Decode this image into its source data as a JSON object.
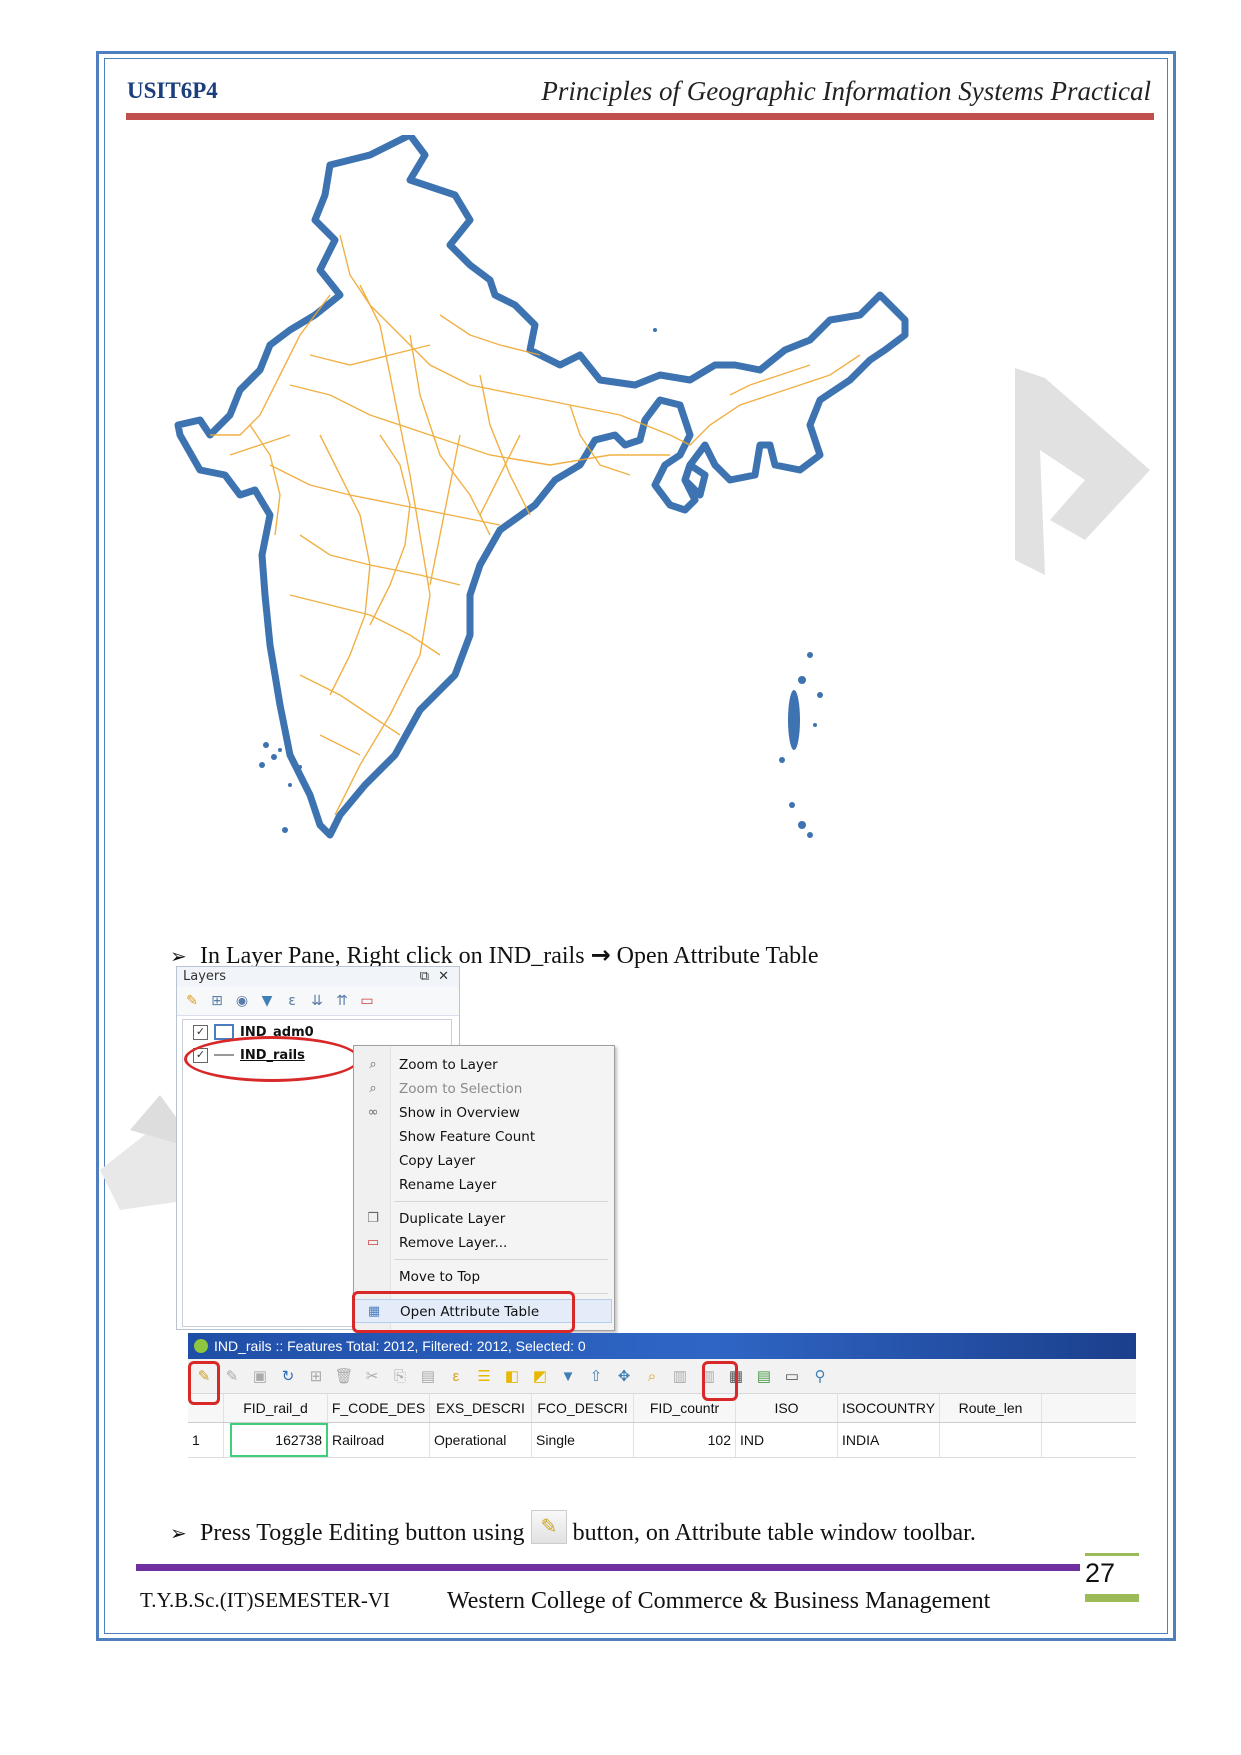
{
  "header": {
    "code": "USIT6P4",
    "title": "Principles of Geographic Information Systems Practical"
  },
  "steps": [
    {
      "text": "In Layer Pane, Right click on IND_rails",
      "arrow": "→",
      "action": "Open Attribute Table"
    },
    {
      "text_before": "Press Toggle Editing button using",
      "text_after": "button, on Attribute table window toolbar."
    }
  ],
  "layers_panel": {
    "title": "Layers",
    "layers": [
      {
        "name": "IND_adm0",
        "checked": true
      },
      {
        "name": "IND_rails",
        "checked": true
      }
    ]
  },
  "context_menu": {
    "items": [
      {
        "label": "Zoom to Layer",
        "enabled": true,
        "icon": "zoom-icon"
      },
      {
        "label": "Zoom to Selection",
        "enabled": false,
        "icon": "zoom-icon"
      },
      {
        "label": "Show in Overview",
        "enabled": true,
        "icon": "overview-icon"
      },
      {
        "label": "Show Feature Count",
        "enabled": true,
        "icon": ""
      },
      {
        "label": "Copy Layer",
        "enabled": true,
        "icon": ""
      },
      {
        "label": "Rename Layer",
        "enabled": true,
        "icon": ""
      },
      {
        "label": "Duplicate Layer",
        "enabled": true,
        "icon": "duplicate-icon"
      },
      {
        "label": "Remove Layer...",
        "enabled": true,
        "icon": "remove-icon"
      },
      {
        "label": "Move to Top",
        "enabled": true,
        "icon": ""
      },
      {
        "label": "Open Attribute Table",
        "enabled": true,
        "icon": "table-icon"
      }
    ]
  },
  "attribute_table": {
    "title": "IND_rails :: Features Total: 2012, Filtered: 2012, Selected: 0",
    "columns": [
      "FID_rail_d",
      "F_CODE_DES",
      "EXS_DESCRI",
      "FCO_DESCRI",
      "FID_countr",
      "ISO",
      "ISOCOUNTRY",
      "Route_len"
    ],
    "rows": [
      {
        "index": "1",
        "cells": [
          "162738",
          "Railroad",
          "Operational",
          "Single",
          "102",
          "IND",
          "INDIA",
          ""
        ]
      }
    ]
  },
  "footer": {
    "left": "T.Y.B.Sc.(IT)SEMESTER-VI",
    "middle": "Western College of Commerce & Business Management",
    "page": "27"
  },
  "colors": {
    "frame": "#4f7fbf",
    "header_rule": "#c0504d",
    "footer_rule": "#7030a0",
    "page_accent": "#9bbb59",
    "map_boundary": "#3c73b0",
    "rail_lines": "#f0a830",
    "highlight": "#d82828"
  }
}
